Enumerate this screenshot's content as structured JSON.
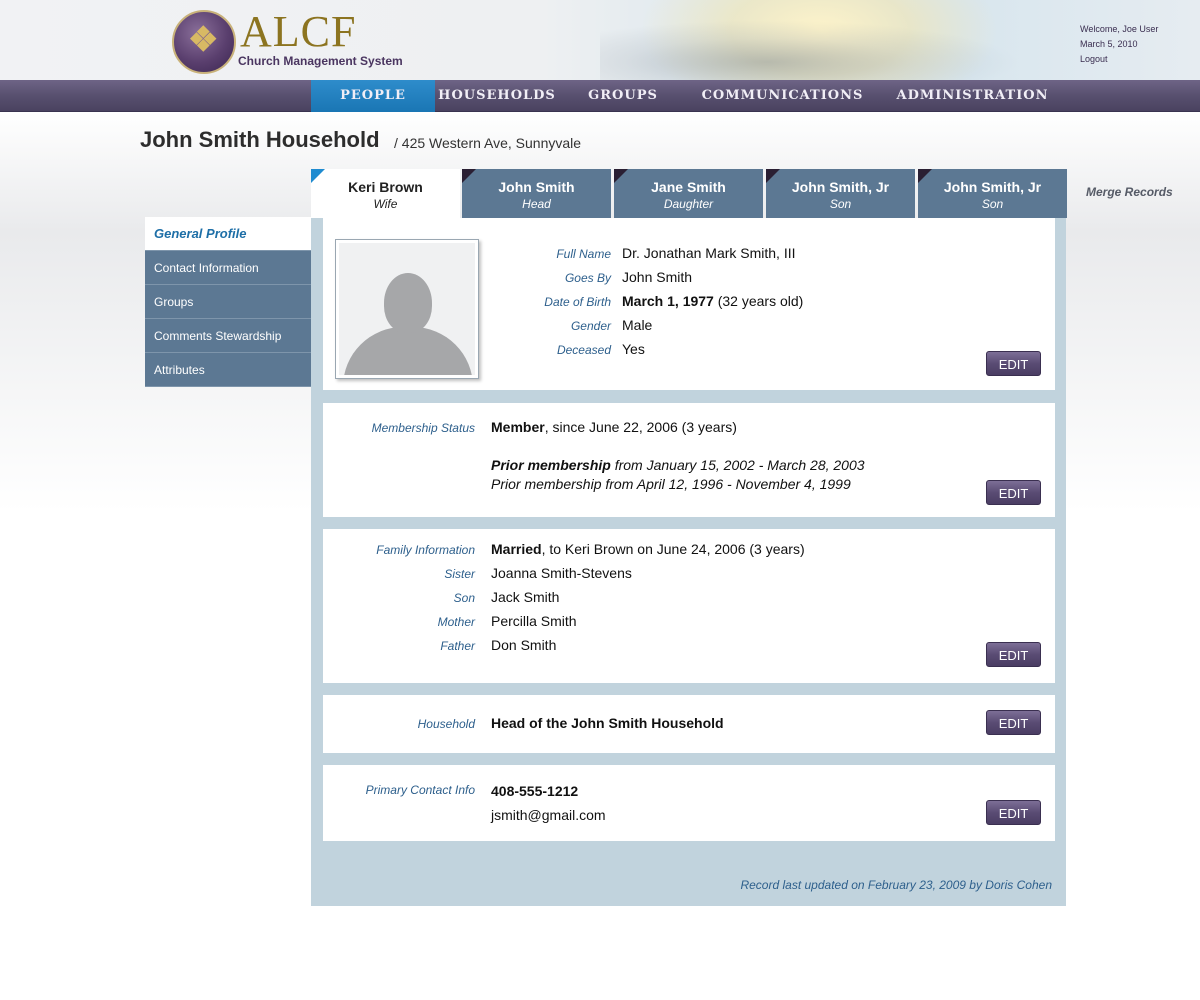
{
  "header": {
    "logo_text": "ALCF",
    "logo_subtitle": "Church Management System",
    "welcome": "Welcome, Joe User",
    "date": "March 5, 2010",
    "logout": "Logout"
  },
  "nav": [
    {
      "label": "PEOPLE",
      "active": true
    },
    {
      "label": "HOUSEHOLDS",
      "active": false
    },
    {
      "label": "GROUPS",
      "active": false
    },
    {
      "label": "COMMUNICATIONS",
      "active": false
    },
    {
      "label": "ADMINISTRATION",
      "active": false
    }
  ],
  "household": {
    "title": "John Smith Household",
    "address": "/  425 Western Ave, Sunnyvale"
  },
  "members": [
    {
      "name": "Keri Brown",
      "role": "Wife",
      "active": true
    },
    {
      "name": "John Smith",
      "role": "Head",
      "active": false
    },
    {
      "name": "Jane Smith",
      "role": "Daughter",
      "active": false
    },
    {
      "name": "John Smith, Jr",
      "role": "Son",
      "active": false
    },
    {
      "name": "John Smith, Jr",
      "role": "Son",
      "active": false
    }
  ],
  "merge_records": "Merge Records",
  "side_nav": [
    {
      "label": "General Profile",
      "active": true
    },
    {
      "label": "Contact Information",
      "active": false
    },
    {
      "label": "Groups",
      "active": false
    },
    {
      "label": "Comments Stewardship",
      "active": false
    },
    {
      "label": "Attributes",
      "active": false
    }
  ],
  "profile": {
    "full_name_label": "Full Name",
    "full_name": "Dr. Jonathan Mark Smith, III",
    "goes_by_label": "Goes By",
    "goes_by": "John Smith",
    "dob_label": "Date of Birth",
    "dob": "March 1, 1977",
    "age": "(32 years old)",
    "gender_label": "Gender",
    "gender": "Male",
    "deceased_label": "Deceased",
    "deceased": "Yes"
  },
  "membership": {
    "label": "Membership Status",
    "status": "Member",
    "since": ", since June 22, 2006 (3 years)",
    "prior1_bold": "Prior membership",
    "prior1_rest": " from January 15, 2002 - March 28, 2003",
    "prior2": "Prior membership from April 12, 1996 - November 4, 1999"
  },
  "family": {
    "label": "Family Information",
    "married": "Married",
    "married_rest": ", to Keri Brown on June 24, 2006 (3 years)",
    "relations": [
      {
        "label": "Sister",
        "name": "Joanna Smith-Stevens"
      },
      {
        "label": "Son",
        "name": "Jack Smith"
      },
      {
        "label": "Mother",
        "name": "Percilla Smith"
      },
      {
        "label": "Father",
        "name": "Don Smith"
      }
    ]
  },
  "household_info": {
    "label": "Household",
    "value": "Head of the John Smith Household"
  },
  "contact": {
    "label": "Primary Contact Info",
    "phone": "408-555-1212",
    "email": "jsmith@gmail.com"
  },
  "edit_label": "EDIT",
  "footer_note": "Record last updated on February 23, 2009 by Doris Cohen",
  "colors": {
    "nav_bg": "#58506f",
    "nav_active": "#1a76b4",
    "tab_bg": "#5c7893",
    "panel_bg": "#c1d3dd",
    "label_color": "#2d5f8c",
    "edit_button": "#5a4c74"
  }
}
